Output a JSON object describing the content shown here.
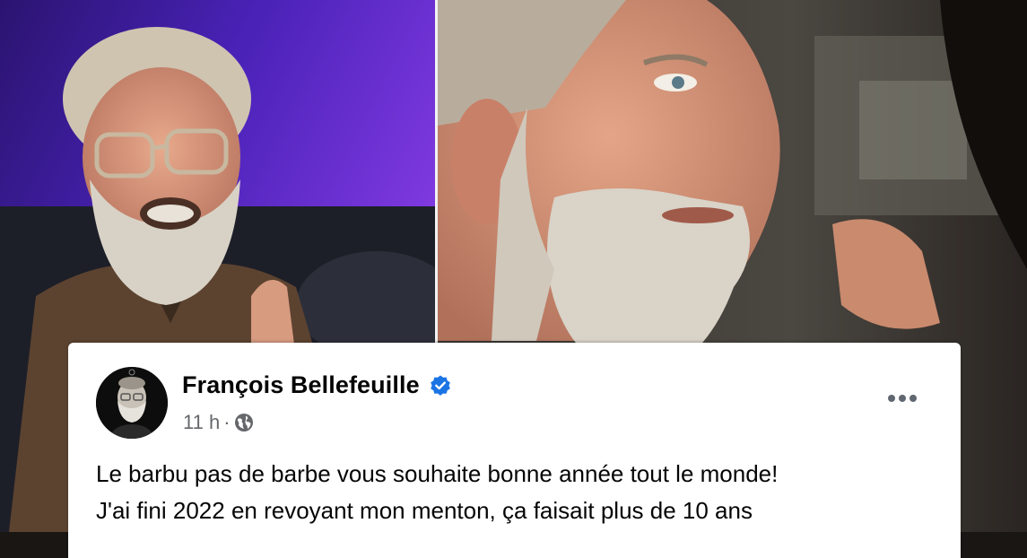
{
  "post": {
    "author_name": "François Bellefeuille",
    "timestamp": "11 h",
    "separator": "·",
    "audience_icon": "globe-icon",
    "verified_icon": "verified-badge-icon",
    "menu_icon": "more-options-icon",
    "text_lines": [
      "Le barbu pas de barbe vous souhaite bonne année tout le monde!",
      "J'ai fini 2022 en revoyant mon menton, ça faisait plus de 10 ans"
    ]
  },
  "colors": {
    "card_background": "#ffffff",
    "name_color": "#050505",
    "meta_color": "#65676b",
    "verified_blue": "#1b74e4",
    "left_photo_backdrop": "#5a2fc8",
    "right_photo_backdrop": "#2a2a28"
  }
}
